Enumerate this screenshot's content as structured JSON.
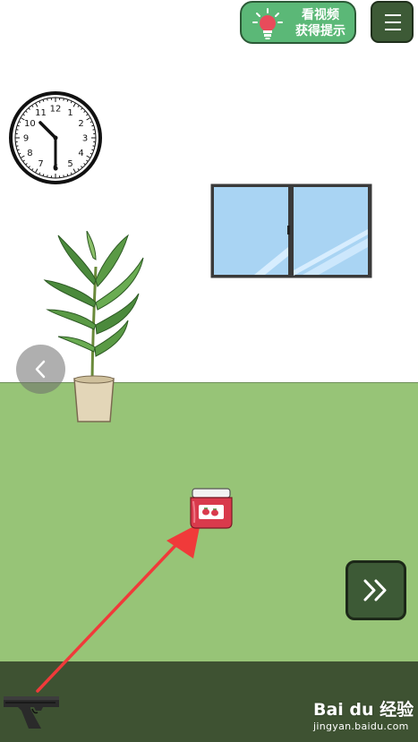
{
  "hint_button": {
    "line1": "看视频",
    "line2": "获得提示",
    "icon": "lightbulb-icon",
    "color": "#5bb877"
  },
  "menu_button": {
    "icon": "hamburger-menu-icon"
  },
  "scene": {
    "wall_color": "#ffffff",
    "floor_color": "#97c477",
    "inventory_bar_color": "#3e5232",
    "clock": {
      "numbers": [
        "12",
        "1",
        "2",
        "3",
        "4",
        "5",
        "6",
        "7",
        "8",
        "9",
        "10",
        "11"
      ]
    },
    "objects": [
      "wall-clock",
      "window",
      "potted-plant",
      "jam-jar",
      "pistol"
    ]
  },
  "navigation": {
    "back_icon": "chevron-left-icon",
    "next_icon": "double-chevron-right-icon"
  },
  "inventory": {
    "items": [
      "pistol"
    ]
  },
  "annotation_arrow_color": "#f03a3a",
  "watermark": {
    "logo": "Bai du 经验",
    "url": "jingyan.baidu.com"
  }
}
